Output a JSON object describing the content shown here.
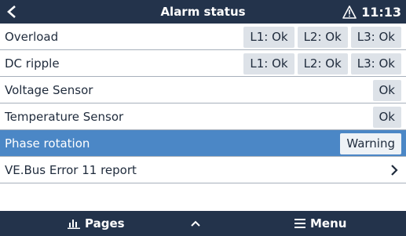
{
  "header": {
    "title": "Alarm status",
    "time": "11:13"
  },
  "rows": [
    {
      "label": "Overload",
      "chips": [
        "L1: Ok",
        "L2: Ok",
        "L3: Ok"
      ]
    },
    {
      "label": "DC ripple",
      "chips": [
        "L1: Ok",
        "L2: Ok",
        "L3: Ok"
      ]
    },
    {
      "label": "Voltage Sensor",
      "chips": [
        "Ok"
      ]
    },
    {
      "label": "Temperature Sensor",
      "chips": [
        "Ok"
      ]
    },
    {
      "label": "Phase rotation",
      "chips": [
        "Warning"
      ],
      "selected": true
    },
    {
      "label": "VE.Bus Error 11 report",
      "chips": []
    }
  ],
  "footer": {
    "pages_label": "Pages",
    "menu_label": "Menu"
  },
  "colors": {
    "bar": "#23334b",
    "selection": "#4b87c6",
    "chip": "#dde2e8",
    "text": "#1f2b3c"
  }
}
